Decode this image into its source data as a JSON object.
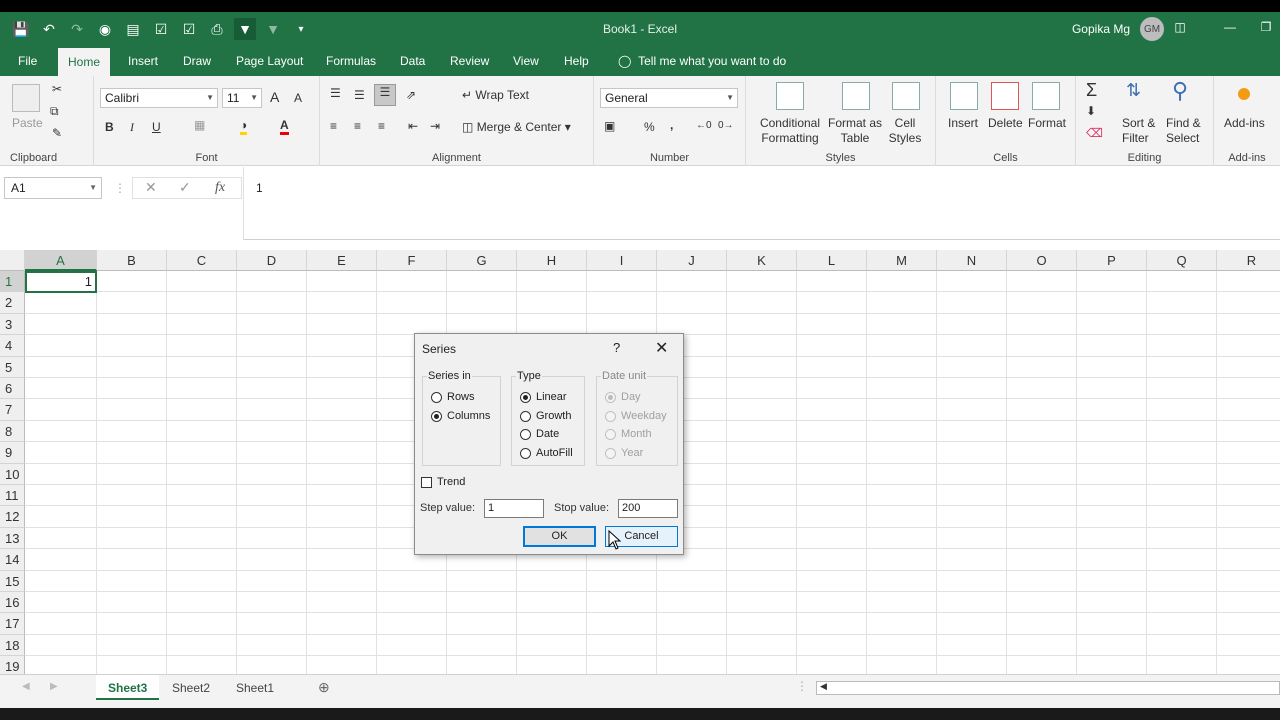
{
  "window": {
    "title": "Book1 - Excel",
    "user_name": "Gopika Mg",
    "user_initials": "GM"
  },
  "ribbon_tabs": [
    "File",
    "Home",
    "Insert",
    "Draw",
    "Page Layout",
    "Formulas",
    "Data",
    "Review",
    "View",
    "Help"
  ],
  "active_tab": "Home",
  "tell_me": "Tell me what you want to do",
  "ribbon": {
    "clipboard": {
      "paste": "Paste",
      "label": "Clipboard"
    },
    "font": {
      "family": "Calibri",
      "size": "11",
      "bold": "B",
      "italic": "I",
      "underline": "U",
      "grow": "A",
      "shrink": "A",
      "label": "Font"
    },
    "alignment": {
      "wrap_text": "Wrap Text",
      "merge_center": "Merge & Center",
      "label": "Alignment"
    },
    "number": {
      "format": "General",
      "percent": "%",
      "comma": ",",
      "label": "Number"
    },
    "styles": {
      "conditional_1": "Conditional",
      "conditional_2": "Formatting",
      "format_table_1": "Format as",
      "format_table_2": "Table",
      "cell_styles_1": "Cell",
      "cell_styles_2": "Styles",
      "label": "Styles"
    },
    "cells": {
      "insert": "Insert",
      "delete": "Delete",
      "format": "Format",
      "label": "Cells"
    },
    "editing": {
      "sort_1": "Sort &",
      "sort_2": "Filter",
      "find_1": "Find &",
      "find_2": "Select",
      "label": "Editing"
    },
    "addins": {
      "addins": "Add-ins",
      "label": "Add-ins"
    }
  },
  "formula_bar": {
    "name_box": "A1",
    "fx": "fx",
    "content": "1"
  },
  "columns": [
    "A",
    "B",
    "C",
    "D",
    "E",
    "F",
    "G",
    "H",
    "I",
    "J",
    "K",
    "L",
    "M",
    "N",
    "O",
    "P",
    "Q",
    "R"
  ],
  "rows": [
    "1",
    "2",
    "3",
    "4",
    "5",
    "6",
    "7",
    "8",
    "9",
    "10",
    "11",
    "12",
    "13",
    "14",
    "15",
    "16",
    "17",
    "18",
    "19"
  ],
  "cells": {
    "A1": "1"
  },
  "dialog": {
    "title": "Series",
    "help": "?",
    "close": "✕",
    "series_in": {
      "label": "Series in",
      "rows": "Rows",
      "columns": "Columns",
      "selected": "Columns"
    },
    "type": {
      "label": "Type",
      "linear": "Linear",
      "growth": "Growth",
      "date": "Date",
      "autofill": "AutoFill",
      "selected": "Linear"
    },
    "date_unit": {
      "label": "Date unit",
      "day": "Day",
      "weekday": "Weekday",
      "month": "Month",
      "year": "Year",
      "selected": "Day"
    },
    "trend": "Trend",
    "step_label": "Step value:",
    "step_value": "1",
    "stop_label": "Stop value:",
    "stop_value": "200",
    "ok": "OK",
    "cancel": "Cancel"
  },
  "sheets": [
    "Sheet3",
    "Sheet2",
    "Sheet1"
  ],
  "active_sheet": "Sheet3",
  "colors": {
    "excel_green": "#217346",
    "dialog_bg": "#f0f0f0",
    "focus_blue": "#0078d7"
  }
}
